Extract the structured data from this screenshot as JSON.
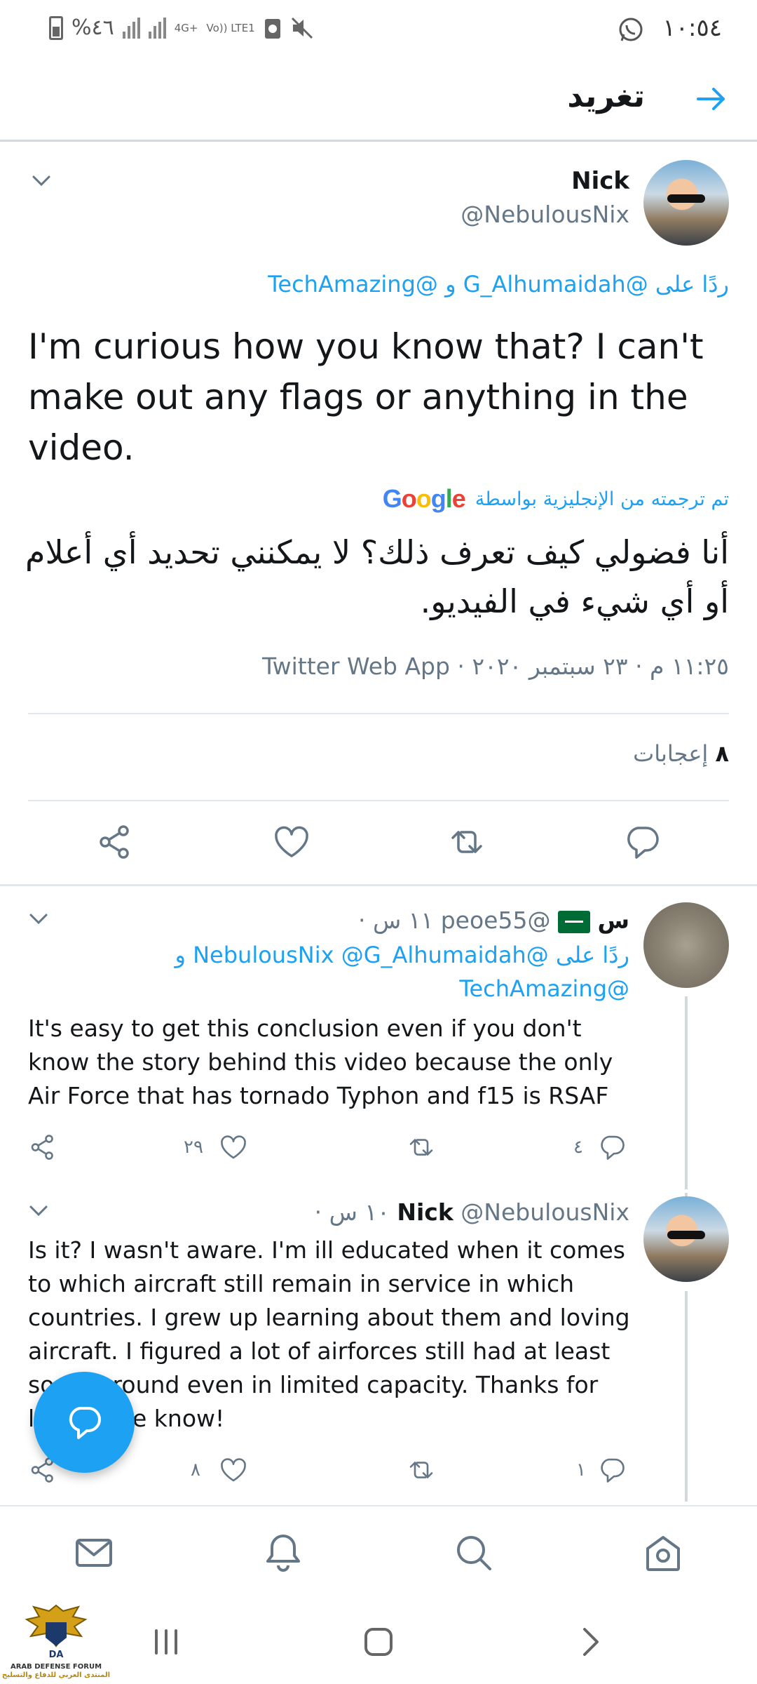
{
  "status_bar": {
    "time": "١٠:٥٤",
    "battery": "%٤٦",
    "network_4g": "4G+",
    "network_volte": "Vo)) LTE1"
  },
  "header": {
    "title": "تغريد"
  },
  "main_tweet": {
    "name": "Nick",
    "handle": "@NebulousNix",
    "reply_to": "ردًا على @G_Alhumaidah و @TechAmazing",
    "text": "I'm curious how you know that? I can't make out any flags or anything in the video.",
    "translated_label": "تم ترجمته من الإنجليزية بواسطة",
    "translator": "Google",
    "translation": "أنا فضولي كيف تعرف ذلك؟ لا يمكنني تحديد أي أعلام أو أي شيء في الفيديو.",
    "meta": "١١:٢٥ م · ٢٣ سبتمبر ٢٠٢٠ · Twitter Web App",
    "likes_count": "٨",
    "likes_label": "إعجابات"
  },
  "replies": [
    {
      "name": "س",
      "handle": "@peoe55",
      "time": "١١ س ·",
      "reply_to_line1": "ردًا على @NebulousNix @G_Alhumaidah و",
      "reply_to_line2": "@TechAmazing",
      "text": "It's easy to get this conclusion even if you don't know the story behind this video because the only Air Force that has tornado Typhon and f15 is RSAF",
      "like_count": "٢٩",
      "reply_count": "٤"
    },
    {
      "name": "Nick",
      "handle": "@NebulousNix",
      "time": "١٠ س ·",
      "text": "Is it? I wasn't aware. I'm ill educated when it comes to which aircraft still remain in service in which countries. I grew up learning about them and loving aircraft. I figured a lot of airforces still had at least some around even in limited capacity. Thanks for letting me know!",
      "like_count": "٨",
      "reply_count": "١"
    }
  ],
  "watermark": {
    "line1": "ARAB DEFENSE FORUM",
    "line2": "المنتدى العربي للدفاع والتسليح",
    "logo_text": "DA"
  },
  "colors": {
    "accent": "#1da1f2",
    "text": "#14171a",
    "secondary": "#657786"
  }
}
